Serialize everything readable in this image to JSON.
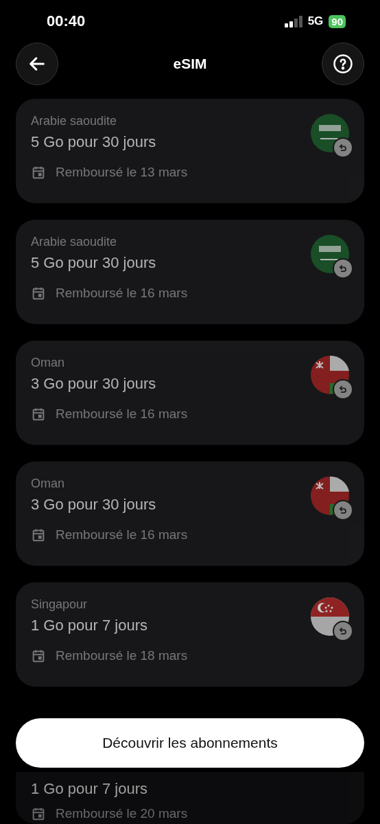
{
  "status_bar": {
    "time": "00:40",
    "network": "5G",
    "battery": "90"
  },
  "header": {
    "title": "eSIM"
  },
  "cards": [
    {
      "country": "Arabie saoudite",
      "plan": "5 Go pour 30 jours",
      "date": "Remboursé le 13 mars",
      "kind": "saudi"
    },
    {
      "country": "Arabie saoudite",
      "plan": "5 Go pour 30 jours",
      "date": "Remboursé le 16 mars",
      "kind": "saudi"
    },
    {
      "country": "Oman",
      "plan": "3 Go pour 30 jours",
      "date": "Remboursé le 16 mars",
      "kind": "oman"
    },
    {
      "country": "Oman",
      "plan": "3 Go pour 30 jours",
      "date": "Remboursé le 16 mars",
      "kind": "oman"
    },
    {
      "country": "Singapour",
      "plan": "1 Go pour 7 jours",
      "date": "Remboursé le 18 mars",
      "kind": "singapore"
    },
    {
      "plan": "1 Go pour 7 jours",
      "date": "Remboursé le 20 mars"
    }
  ],
  "cta": {
    "label": "Découvrir les abonnements"
  }
}
